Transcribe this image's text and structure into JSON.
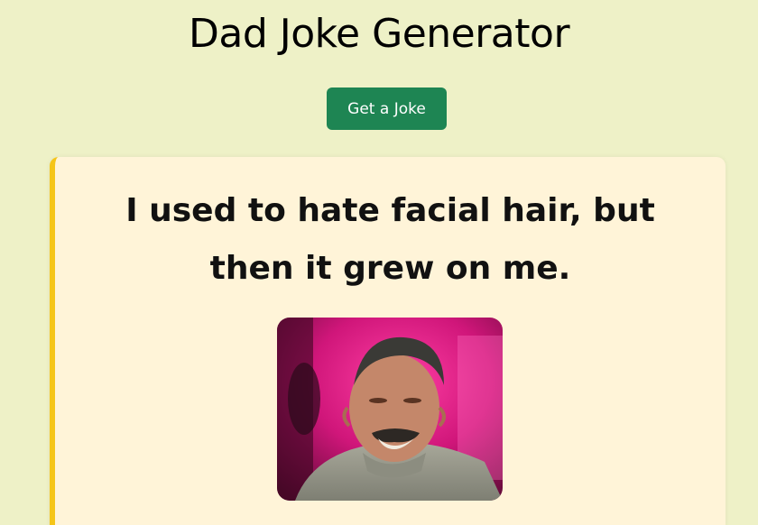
{
  "header": {
    "title": "Dad Joke Generator"
  },
  "controls": {
    "get_joke_label": "Get a Joke"
  },
  "joke": {
    "text": "I used to hate facial hair, but then it grew on me."
  },
  "colors": {
    "background": "#eef1c7",
    "button": "#1e8553",
    "card": "#fff4d8",
    "card_accent": "#f5c518"
  }
}
